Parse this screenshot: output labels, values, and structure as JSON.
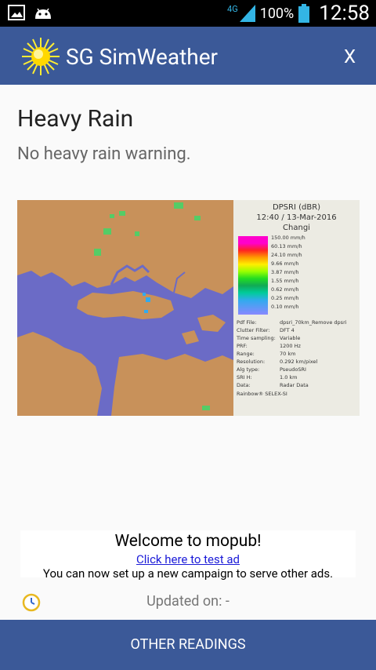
{
  "status_bar": {
    "network": "4G",
    "battery": "100%",
    "time": "12:58"
  },
  "app_bar": {
    "title": "SG SimWeather",
    "close_label": "X"
  },
  "content": {
    "heading": "Heavy Rain",
    "warning": "No heavy rain warning."
  },
  "radar": {
    "legend_title": "DPSRI (dBR)",
    "datetime": "12:40 / 13-Mar-2016",
    "station": "Changi",
    "scale": [
      "150.00 mm/h",
      "60.13 mm/h",
      "24.10 mm/h",
      "9.66 mm/h",
      "3.87 mm/h",
      "1.55 mm/h",
      "0.62 mm/h",
      "0.25 mm/h",
      "0.10 mm/h"
    ],
    "meta": [
      {
        "key": "Pdf File:",
        "value": "dpsri_70km_Remove dpsri"
      },
      {
        "key": "Clutter Filter:",
        "value": "DFT 4"
      },
      {
        "key": "Time sampling:",
        "value": "Variable"
      },
      {
        "key": "PRF:",
        "value": "1200 Hz"
      },
      {
        "key": "Range:",
        "value": "70 km"
      },
      {
        "key": "Resolution:",
        "value": "0.292 km/pixel"
      },
      {
        "key": "Alg type:",
        "value": "PseudoSRI"
      },
      {
        "key": "SRI H:",
        "value": "1.0 km"
      },
      {
        "key": "Data:",
        "value": "Radar Data"
      }
    ],
    "credit": "Rainbow® SELEX-SI",
    "colors": {
      "sea": "#6b6bc6",
      "land": "#c8915a"
    }
  },
  "ad": {
    "title": "Welcome to mopub!",
    "link": "Click here to test ad",
    "body": "You can now set up a new campaign to serve other ads."
  },
  "footer": {
    "updated": "Updated on: -",
    "button": "OTHER READINGS"
  },
  "colors": {
    "accent": "#3b5998"
  }
}
